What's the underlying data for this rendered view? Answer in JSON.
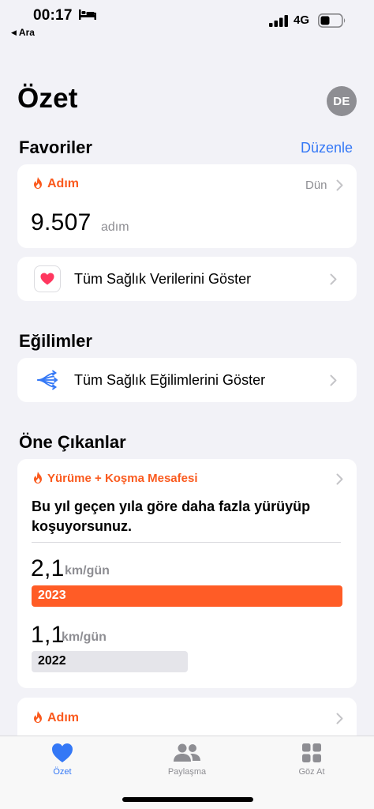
{
  "status_bar": {
    "time": "00:17",
    "back_app": "Ara",
    "network": "4G"
  },
  "header": {
    "title": "Özet",
    "avatar_initials": "DE"
  },
  "favorites": {
    "section_title": "Favoriler",
    "edit_label": "Düzenle",
    "steps_card": {
      "label": "Adım",
      "date": "Dün",
      "value": "9.507",
      "unit": "adım"
    },
    "all_data_label": "Tüm Sağlık Verilerini Göster"
  },
  "trends": {
    "section_title": "Eğilimler",
    "all_trends_label": "Tüm Sağlık Eğilimlerini Göster"
  },
  "highlights": {
    "section_title": "Öne Çıkanlar",
    "card": {
      "label": "Yürüme + Koşma Mesafesi",
      "description": "Bu yıl geçen yıla göre daha fazla yürüyüp koşuyorsunuz.",
      "current": {
        "value": "2,1",
        "unit": "km/gün",
        "year": "2023",
        "amount": 2.1
      },
      "previous": {
        "value": "1,1",
        "unit": "km/gün",
        "year": "2022",
        "amount": 1.1
      }
    },
    "next_card_label": "Adım"
  },
  "tab_bar": {
    "tabs": [
      {
        "label": "Özet",
        "icon": "heart-icon",
        "active": true
      },
      {
        "label": "Paylaşma",
        "icon": "people-icon",
        "active": false
      },
      {
        "label": "Göz At",
        "icon": "grid-icon",
        "active": false
      }
    ]
  },
  "colors": {
    "accent": "#3478f6",
    "activity": "#fa5a1e",
    "bar_current": "#ff5c26",
    "bar_previous": "#e5e5ea"
  }
}
